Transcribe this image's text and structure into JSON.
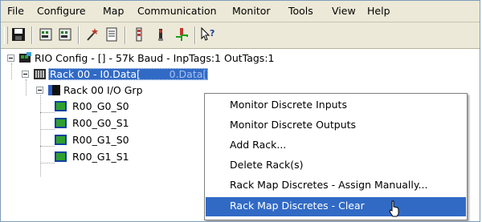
{
  "menubar": {
    "items": [
      "File",
      "Configure",
      "Map",
      "Communication",
      "Monitor",
      "Tools",
      "View",
      "Help"
    ]
  },
  "toolbar": {
    "buttons": [
      {
        "icon": "save-icon"
      },
      {
        "icon": "scanner-config-icon"
      },
      {
        "icon": "scanner-config-icon-2"
      },
      {
        "icon": "wand-icon"
      },
      {
        "icon": "report-icon"
      },
      {
        "icon": "module-icon"
      },
      {
        "icon": "power-icon"
      },
      {
        "icon": "network-icon"
      },
      {
        "icon": "help-cursor-icon"
      }
    ]
  },
  "tree": {
    "root": "RIO Config - [] - 57k Baud - InpTags:1 OutTags:1",
    "rack": "Rack 00 - I0.Data[",
    "rack_suffix": "0.Data[",
    "group": "Rack 00 I/O Grp",
    "slots": [
      "R00_G0_S0",
      "R00_G0_S1",
      "R00_G1_S0",
      "R00_G1_S1"
    ]
  },
  "context_menu": {
    "items": [
      "Monitor Discrete Inputs",
      "Monitor Discrete Outputs",
      "Add Rack...",
      "Delete Rack(s)",
      "Rack Map Discretes - Assign Manually...",
      "Rack Map Discretes - Clear"
    ],
    "highlighted_index": 5
  },
  "colors": {
    "selection": "#316ac5",
    "menubar_bg": "#ece9d8"
  }
}
